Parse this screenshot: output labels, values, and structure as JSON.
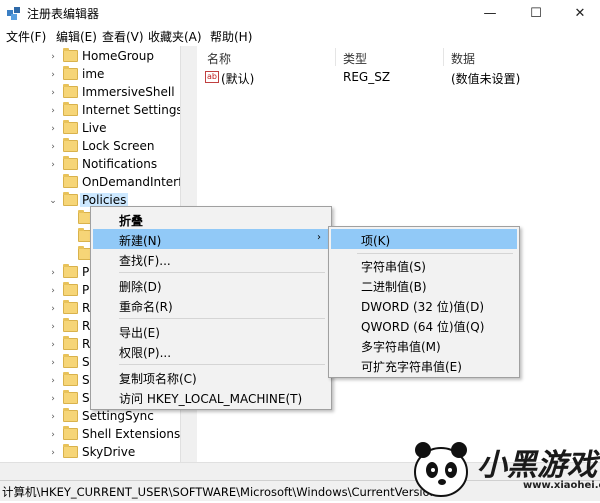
{
  "window": {
    "title": "注册表编辑器",
    "controls": {
      "minimize": "—",
      "maximize": "☐",
      "close": "✕"
    }
  },
  "menubar": [
    "文件(F)",
    "编辑(E)",
    "查看(V)",
    "收藏夹(A)",
    "帮助(H)"
  ],
  "tree": {
    "items": [
      {
        "label": "HomeGroup",
        "arrow": "›"
      },
      {
        "label": "ime",
        "arrow": "›"
      },
      {
        "label": "ImmersiveShell",
        "arrow": "›"
      },
      {
        "label": "Internet Settings",
        "arrow": "›"
      },
      {
        "label": "Live",
        "arrow": "›"
      },
      {
        "label": "Lock Screen",
        "arrow": "›"
      },
      {
        "label": "Notifications",
        "arrow": "›"
      },
      {
        "label": "OnDemandInterfa",
        "arrow": ""
      },
      {
        "label": "Policies",
        "arrow": "⌄"
      }
    ],
    "lower_items": [
      {
        "label": "P",
        "arrow": "›"
      },
      {
        "label": "P",
        "arrow": "›"
      },
      {
        "label": "R",
        "arrow": "›"
      },
      {
        "label": "R",
        "arrow": "›"
      },
      {
        "label": "R",
        "arrow": "›"
      },
      {
        "label": "S",
        "arrow": "›"
      },
      {
        "label": "S",
        "arrow": "›"
      },
      {
        "label": "S",
        "arrow": "›"
      },
      {
        "label": "SettingSync",
        "arrow": "›"
      },
      {
        "label": "Shell Extensions",
        "arrow": "›"
      },
      {
        "label": "SkyDrive",
        "arrow": "›"
      }
    ]
  },
  "values_pane": {
    "columns": [
      "名称",
      "类型",
      "数据"
    ],
    "rows": [
      {
        "icon": "ab",
        "name": "(默认)",
        "type": "REG_SZ",
        "data": "(数值未设置)"
      }
    ]
  },
  "context_menu": {
    "items": [
      "折叠",
      "新建(N)",
      "查找(F)...",
      "删除(D)",
      "重命名(R)",
      "导出(E)",
      "权限(P)...",
      "复制项名称(C)",
      "访问 HKEY_LOCAL_MACHINE(T)"
    ],
    "submenu_arrow": "›"
  },
  "submenu": {
    "items": [
      "项(K)",
      "字符串值(S)",
      "二进制值(B)",
      "DWORD (32 位)值(D)",
      "QWORD (64 位)值(Q)",
      "多字符串值(M)",
      "可扩充字符串值(E)"
    ]
  },
  "statusbar": {
    "path": "计算机\\HKEY_CURRENT_USER\\SOFTWARE\\Microsoft\\Windows\\CurrentVersion\\"
  },
  "watermark": {
    "brand": "小黑游戏",
    "url": "www.xiaohei.com"
  }
}
